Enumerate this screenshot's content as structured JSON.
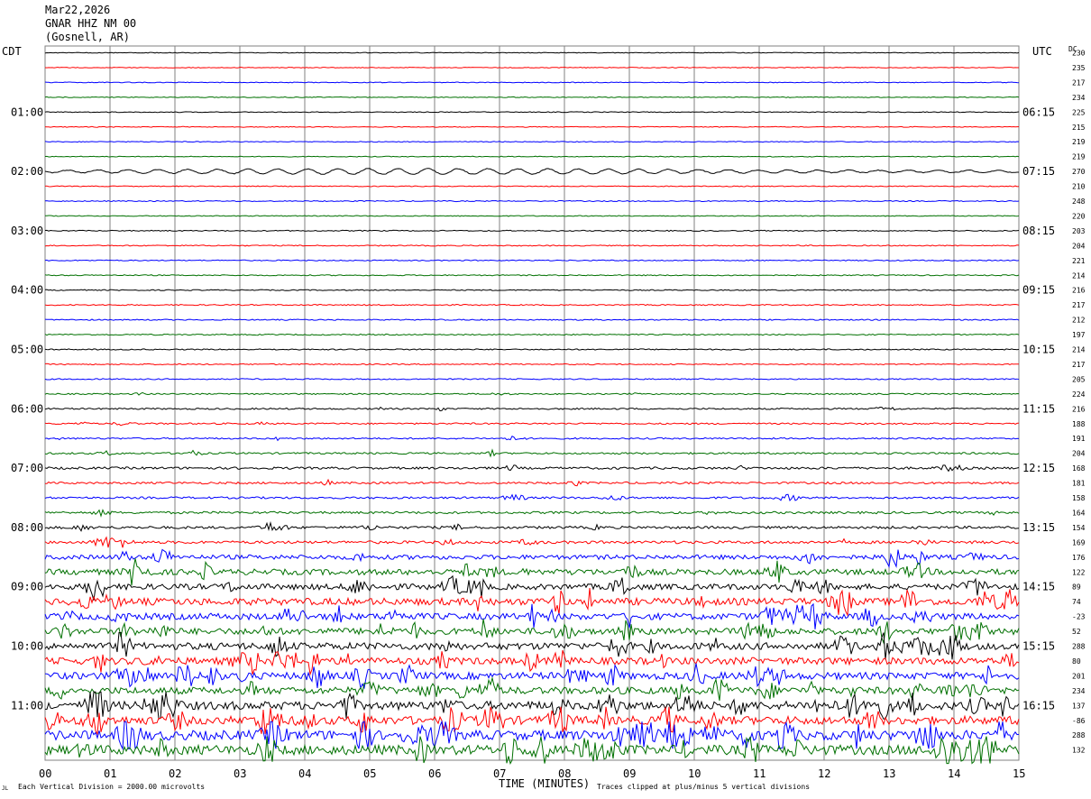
{
  "header": {
    "date": "Mar22,2026",
    "station": "GNAR HHZ NM 00",
    "location": "(Gosnell, AR)"
  },
  "left_zone_label": "CDT",
  "right_zone_label": "UTC",
  "dc_label": "DC",
  "footer": {
    "corner_mark": "JL",
    "vertical_division": "Each Vertical Division = 2000.00 microvolts",
    "time_axis_label": "TIME (MINUTES)",
    "clip_note": "Traces clipped at plus/minus 5 vertical divisions"
  },
  "colors": {
    "trace_cycle": [
      "#000000",
      "#ff0000",
      "#0000ff",
      "#007000"
    ],
    "grid": "#808080",
    "text": "#000000"
  },
  "chart_data": {
    "type": "line",
    "title": "",
    "xlabel": "TIME (MINUTES)",
    "xlim": [
      0,
      15
    ],
    "x_ticks": [
      "00",
      "01",
      "02",
      "03",
      "04",
      "05",
      "06",
      "07",
      "08",
      "09",
      "10",
      "11",
      "12",
      "13",
      "14",
      "15"
    ],
    "trace_count": 48,
    "traces_per_hour": 4,
    "left_time_labels": [
      "01:00",
      "02:00",
      "03:00",
      "04:00",
      "05:00",
      "06:00",
      "07:00",
      "08:00",
      "09:00",
      "10:00",
      "11:00"
    ],
    "right_time_labels": [
      "06:15",
      "07:15",
      "08:15",
      "09:15",
      "10:15",
      "11:15",
      "12:15",
      "13:15",
      "14:15",
      "15:15",
      "16:15"
    ],
    "dc_offsets": [
      "230",
      "235",
      "217",
      "234",
      "225",
      "215",
      "219",
      "219",
      "270",
      "210",
      "248",
      "220",
      "203",
      "204",
      "221",
      "214",
      "216",
      "217",
      "212",
      "197",
      "214",
      "217",
      "205",
      "224",
      "216",
      "188",
      "191",
      "204",
      "168",
      "181",
      "158",
      "164",
      "154",
      "169",
      "176",
      "122",
      "89",
      "74",
      "-23",
      "52",
      "288",
      "80",
      "201",
      "234",
      "137",
      "-86",
      "288",
      "132"
    ],
    "trace_noise_level": [
      0.6,
      0.6,
      0.6,
      0.6,
      0.6,
      0.6,
      0.6,
      0.6,
      0.6,
      0.7,
      0.8,
      0.7,
      0.8,
      0.8,
      0.8,
      0.8,
      0.8,
      0.9,
      0.9,
      0.9,
      0.9,
      0.9,
      0.9,
      1.0,
      1.2,
      1.2,
      1.2,
      1.4,
      1.8,
      1.6,
      1.6,
      1.8,
      2.0,
      2.2,
      3.5,
      4.5,
      4.5,
      5.5,
      5.0,
      5.0,
      5.5,
      5.5,
      5.5,
      5.5,
      6.5,
      6.5,
      7.5,
      7.5
    ],
    "oscillating_trace_index": 8
  }
}
